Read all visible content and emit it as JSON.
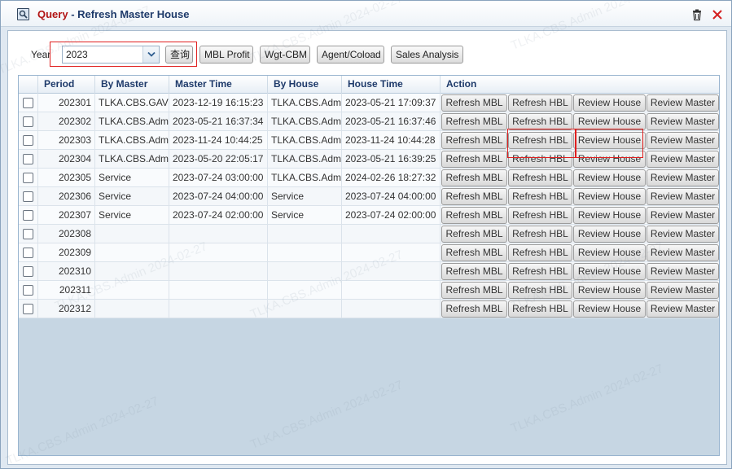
{
  "window": {
    "title_prefix": "Query",
    "title_separator": "-",
    "title_text": "Refresh Master House",
    "icons": [
      "query-icon",
      "trash-icon",
      "close-icon"
    ]
  },
  "toolbar": {
    "year_label": "Year",
    "year_value": "2023",
    "query_button": "查询",
    "mbl_profit_button": "MBL Profit",
    "wgt_cbm_button": "Wgt-CBM",
    "agent_coload_button": "Agent/Coload",
    "sales_analysis_button": "Sales Analysis"
  },
  "grid": {
    "columns": [
      "",
      "Period",
      "By Master",
      "Master Time",
      "By House",
      "House Time",
      "Action"
    ],
    "action_labels": {
      "refresh_mbl": "Refresh MBL",
      "refresh_hbl": "Refresh HBL",
      "review_house": "Review House",
      "review_master": "Review Master"
    },
    "rows": [
      {
        "period": "202301",
        "by_master": "TLKA.CBS.GAV",
        "master_time": "2023-12-19 16:15:23",
        "by_house": "TLKA.CBS.Adm",
        "house_time": "2023-05-21 17:09:37"
      },
      {
        "period": "202302",
        "by_master": "TLKA.CBS.Adm",
        "master_time": "2023-05-21 16:37:34",
        "by_house": "TLKA.CBS.Adm",
        "house_time": "2023-05-21 16:37:46"
      },
      {
        "period": "202303",
        "by_master": "TLKA.CBS.Adm",
        "master_time": "2023-11-24 10:44:25",
        "by_house": "TLKA.CBS.Adm",
        "house_time": "2023-11-24 10:44:28"
      },
      {
        "period": "202304",
        "by_master": "TLKA.CBS.Adm",
        "master_time": "2023-05-20 22:05:17",
        "by_house": "TLKA.CBS.Adm",
        "house_time": "2023-05-21 16:39:25"
      },
      {
        "period": "202305",
        "by_master": "Service",
        "master_time": "2023-07-24 03:00:00",
        "by_house": "TLKA.CBS.Adm",
        "house_time": "2024-02-26 18:27:32"
      },
      {
        "period": "202306",
        "by_master": "Service",
        "master_time": "2023-07-24 04:00:00",
        "by_house": "Service",
        "house_time": "2023-07-24 04:00:00"
      },
      {
        "period": "202307",
        "by_master": "Service",
        "master_time": "2023-07-24 02:00:00",
        "by_house": "Service",
        "house_time": "2023-07-24 02:00:00"
      },
      {
        "period": "202308",
        "by_master": "",
        "master_time": "",
        "by_house": "",
        "house_time": ""
      },
      {
        "period": "202309",
        "by_master": "",
        "master_time": "",
        "by_house": "",
        "house_time": ""
      },
      {
        "period": "202310",
        "by_master": "",
        "master_time": "",
        "by_house": "",
        "house_time": ""
      },
      {
        "period": "202311",
        "by_master": "",
        "master_time": "",
        "by_house": "",
        "house_time": ""
      },
      {
        "period": "202312",
        "by_master": "",
        "master_time": "",
        "by_house": "",
        "house_time": ""
      }
    ]
  },
  "watermark_text": [
    "TLKA.CBS.Admin 2024-02-27"
  ],
  "colors": {
    "accent_red": "#b21414",
    "title_blue": "#1e3a6a",
    "grid_bg": "#c6d6e3"
  }
}
